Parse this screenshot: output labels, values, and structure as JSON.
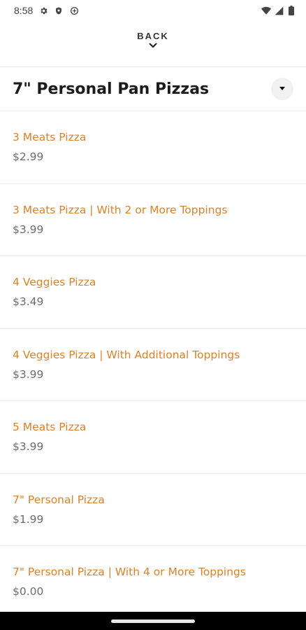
{
  "status_bar": {
    "time": "8:58",
    "left_icons": [
      "gear-icon",
      "shield-icon",
      "sync-icon"
    ],
    "right_icons": [
      "wifi-icon",
      "signal-icon",
      "battery-icon"
    ]
  },
  "header": {
    "back_label": "BACK"
  },
  "section": {
    "title": "7\" Personal Pan Pizzas"
  },
  "items": [
    {
      "name": "3 Meats Pizza",
      "price": "$2.99"
    },
    {
      "name": "3 Meats Pizza | With 2 or More Toppings",
      "price": "$3.99"
    },
    {
      "name": "4 Veggies Pizza",
      "price": "$3.49"
    },
    {
      "name": "4 Veggies Pizza | With Additional Toppings",
      "price": "$3.99"
    },
    {
      "name": "5 Meats Pizza",
      "price": "$3.99"
    },
    {
      "name": "7\" Personal Pizza",
      "price": "$1.99"
    },
    {
      "name": "7\" Personal Pizza | With 4 or More Toppings",
      "price": "$0.00"
    }
  ],
  "colors": {
    "item_name": "#d9822b",
    "price": "#6d6d6d",
    "nav_bar": "#000000"
  }
}
